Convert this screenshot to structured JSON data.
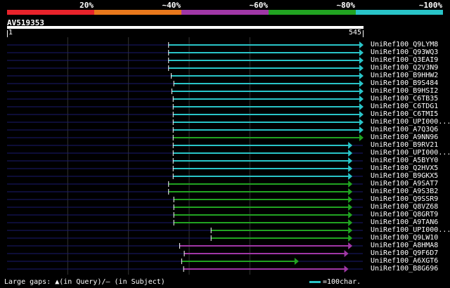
{
  "legend": {
    "labels": [
      "20%",
      "~40%",
      "~60%",
      "~80%",
      "~100%"
    ],
    "colors": [
      "#e8232b",
      "#e8781c",
      "#a037a6",
      "#21a321",
      "#29c4c8"
    ]
  },
  "query": {
    "name": "AV519353",
    "start": "1",
    "end": "545",
    "length": 545
  },
  "hits": [
    {
      "name": "UniRef100_Q9LYM8",
      "start": 248,
      "end": 545,
      "color": "cyan"
    },
    {
      "name": "UniRef100_Q93WQ3",
      "start": 248,
      "end": 545,
      "color": "cyan"
    },
    {
      "name": "UniRef100_Q3EAI9",
      "start": 248,
      "end": 545,
      "color": "cyan"
    },
    {
      "name": "UniRef100_Q2V3N9",
      "start": 248,
      "end": 545,
      "color": "cyan"
    },
    {
      "name": "UniRef100_B9HHW2",
      "start": 252,
      "end": 545,
      "color": "cyan"
    },
    {
      "name": "UniRef100_B9S484",
      "start": 256,
      "end": 545,
      "color": "cyan"
    },
    {
      "name": "UniRef100_B9HSI2",
      "start": 253,
      "end": 545,
      "color": "cyan"
    },
    {
      "name": "UniRef100_C6TB35",
      "start": 255,
      "end": 545,
      "color": "cyan"
    },
    {
      "name": "UniRef100_C6TDG1",
      "start": 255,
      "end": 545,
      "color": "cyan"
    },
    {
      "name": "UniRef100_C6TMI5",
      "start": 255,
      "end": 545,
      "color": "cyan"
    },
    {
      "name": "UniRef100_UPI000...",
      "start": 255,
      "end": 545,
      "color": "cyan"
    },
    {
      "name": "UniRef100_A7Q3Q6",
      "start": 255,
      "end": 545,
      "color": "cyan"
    },
    {
      "name": "UniRef100_A9NN96",
      "start": 255,
      "end": 545,
      "color": "green"
    },
    {
      "name": "UniRef100_B9RV21",
      "start": 255,
      "end": 528,
      "color": "cyan"
    },
    {
      "name": "UniRef100_UPI000...",
      "start": 255,
      "end": 528,
      "color": "cyan"
    },
    {
      "name": "UniRef100_A5BYY0",
      "start": 255,
      "end": 528,
      "color": "cyan"
    },
    {
      "name": "UniRef100_Q2HVX5",
      "start": 255,
      "end": 528,
      "color": "cyan"
    },
    {
      "name": "UniRef100_B9GKX5",
      "start": 255,
      "end": 528,
      "color": "cyan"
    },
    {
      "name": "UniRef100_A9SAT7",
      "start": 248,
      "end": 528,
      "color": "green"
    },
    {
      "name": "UniRef100_A9S3B2",
      "start": 248,
      "end": 528,
      "color": "green"
    },
    {
      "name": "UniRef100_Q9SSR9",
      "start": 256,
      "end": 528,
      "color": "green"
    },
    {
      "name": "UniRef100_Q8VZ68",
      "start": 256,
      "end": 528,
      "color": "green"
    },
    {
      "name": "UniRef100_Q8GRT9",
      "start": 256,
      "end": 528,
      "color": "green"
    },
    {
      "name": "UniRef100_A9TAN6",
      "start": 256,
      "end": 528,
      "color": "green"
    },
    {
      "name": "UniRef100_UPI000...",
      "start": 313,
      "end": 528,
      "color": "green"
    },
    {
      "name": "UniRef100_Q9LW10",
      "start": 313,
      "end": 528,
      "color": "green"
    },
    {
      "name": "UniRef100_A8HMA8",
      "start": 265,
      "end": 528,
      "color": "purple"
    },
    {
      "name": "UniRef100_Q9F6D7",
      "start": 272,
      "end": 522,
      "color": "purple"
    },
    {
      "name": "UniRef100_A6XGT6",
      "start": 268,
      "end": 446,
      "color": "green"
    },
    {
      "name": "UniRef100_B8G696",
      "start": 271,
      "end": 522,
      "color": "purple"
    }
  ],
  "footer": {
    "text": "Large gaps: ▲(in Query)/— (in Subject)",
    "scale_label": "=100char."
  }
}
